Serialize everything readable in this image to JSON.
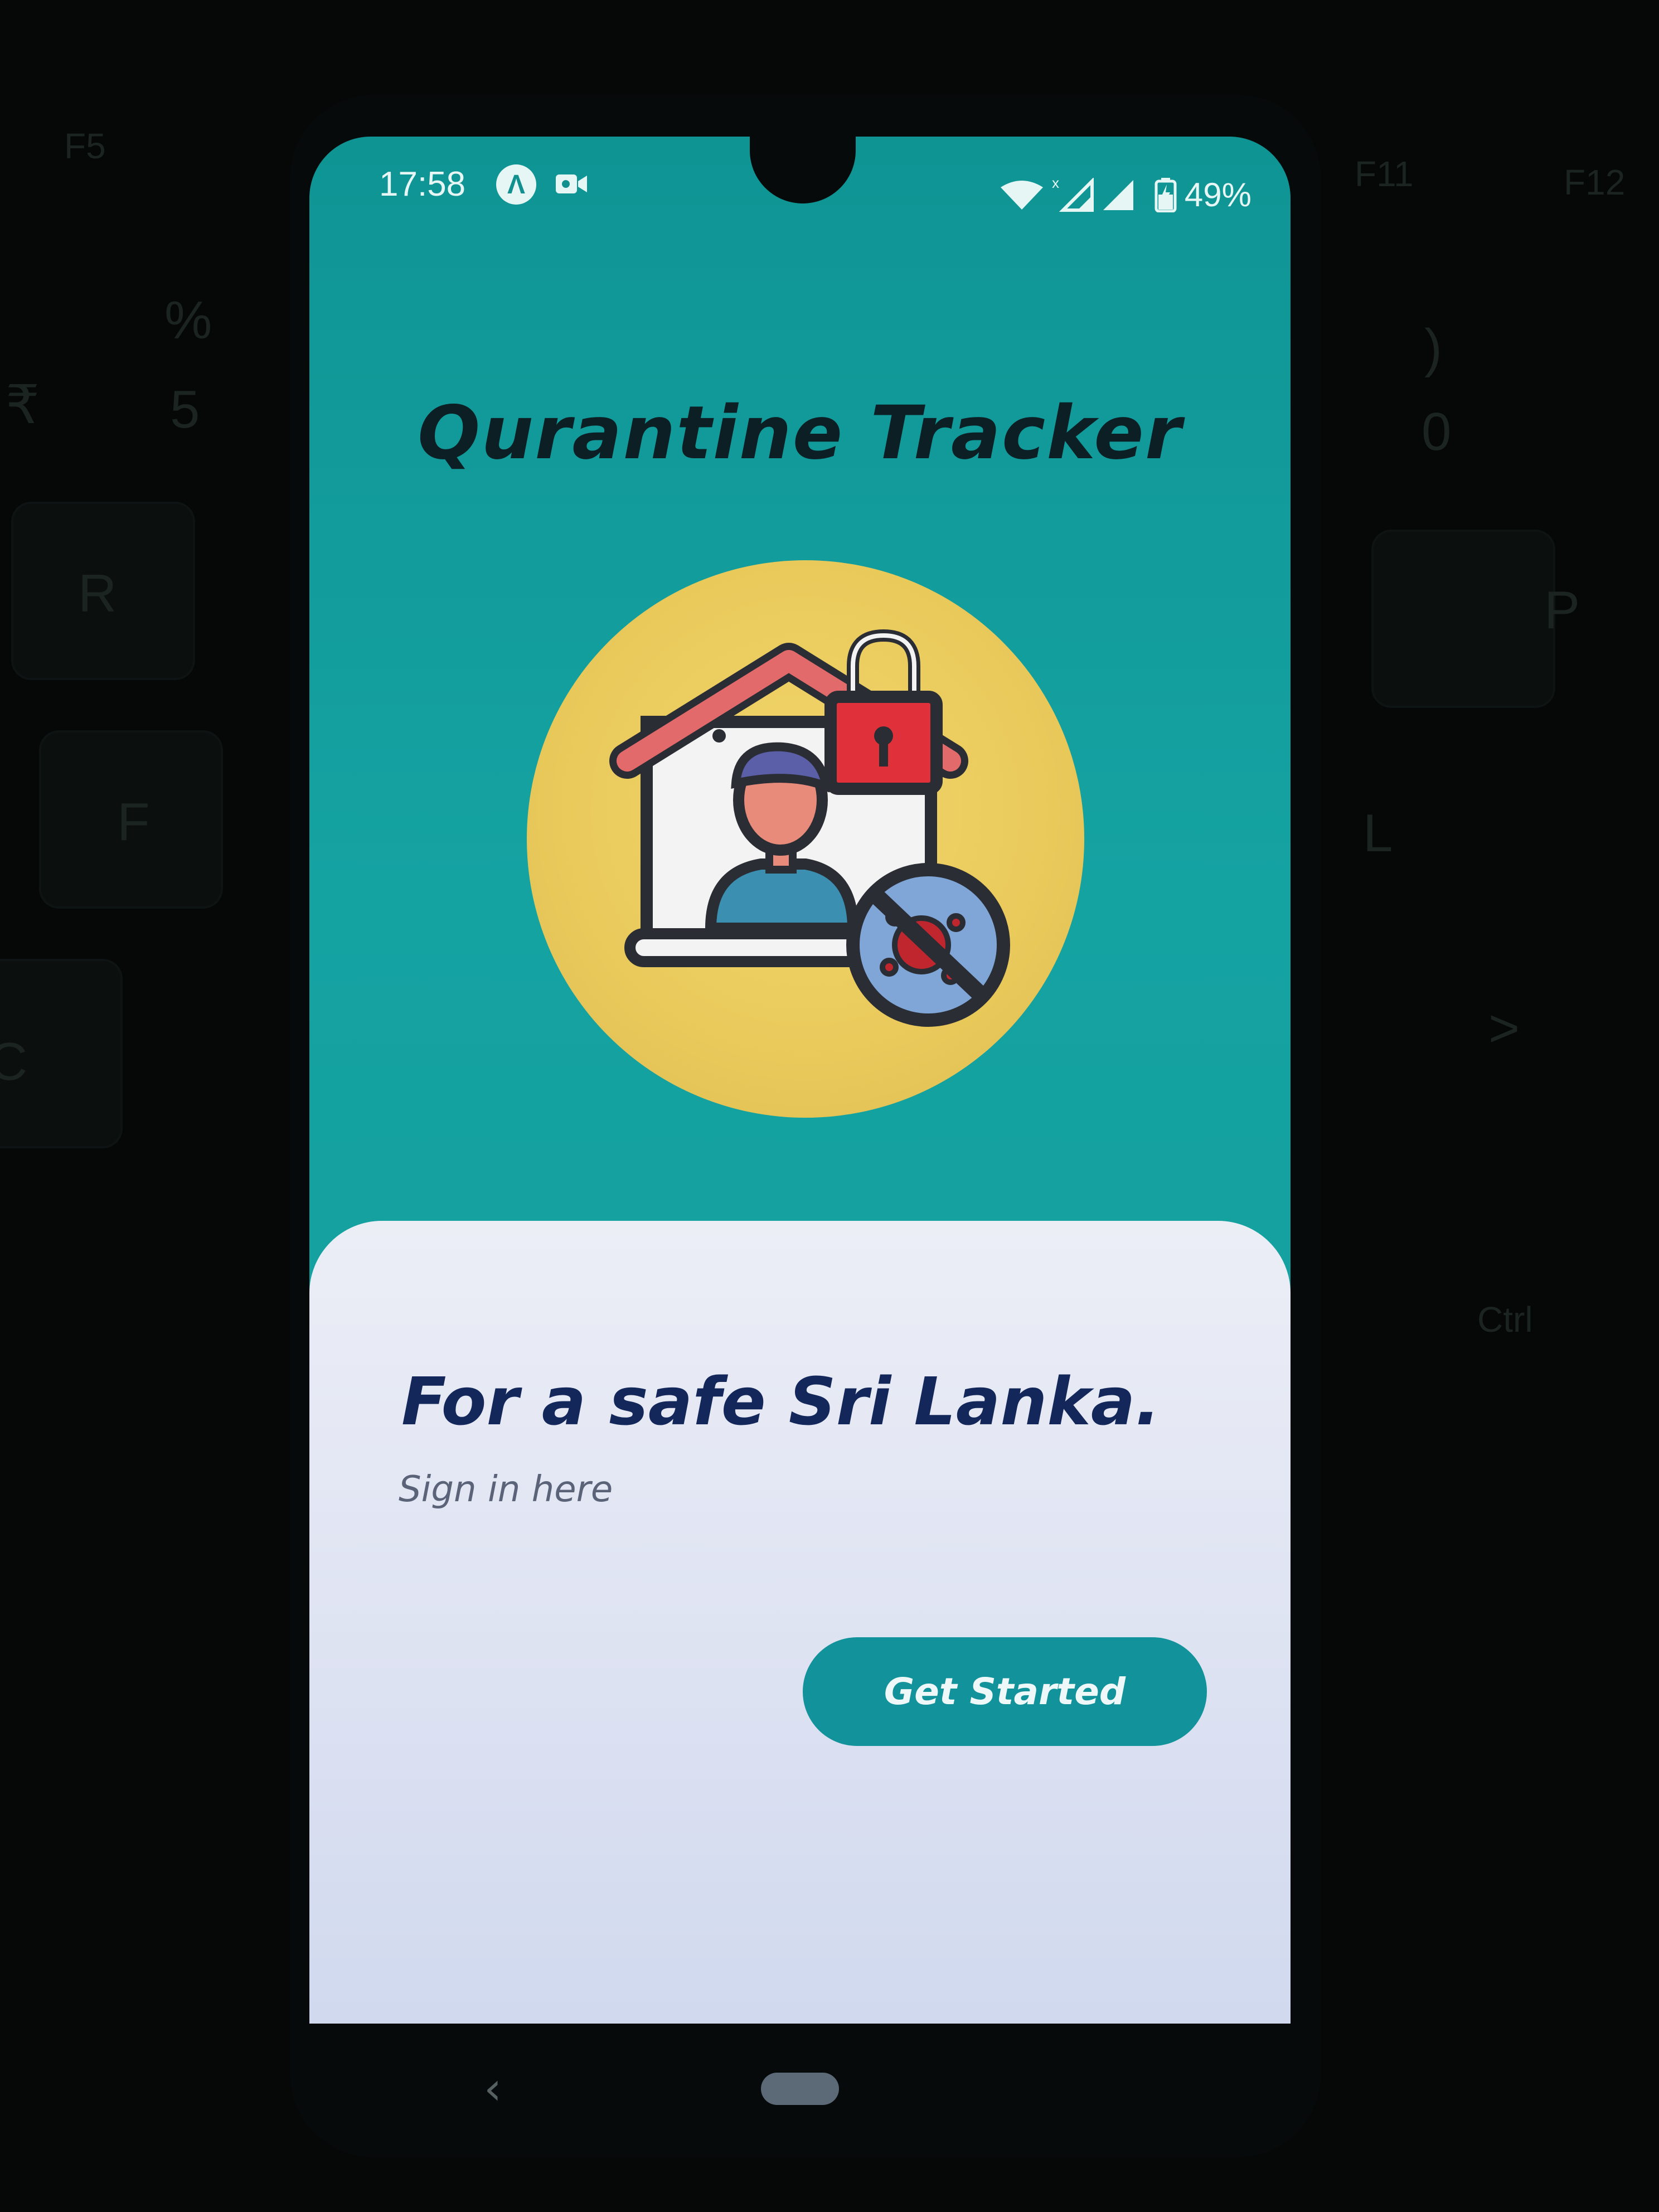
{
  "status_bar": {
    "time": "17:58",
    "app_icon_glyph": "Λ",
    "battery": "49%",
    "icons": [
      "app-notification-icon",
      "video-camera-icon",
      "wifi-icon",
      "signal-icon",
      "battery-icon"
    ]
  },
  "app": {
    "title": "Qurantine Tracker"
  },
  "card": {
    "heading": "For a safe Sri Lanka.",
    "subtitle": "Sign in here",
    "button_label": "Get Started"
  },
  "nav": {
    "back_glyph": "‹"
  },
  "background_keys": [
    "F5",
    "%",
    "₹",
    "5",
    "R",
    "F",
    "C",
    "F11",
    "F12",
    ")",
    "0",
    "P",
    "L",
    ">",
    "Ctrl"
  ],
  "colors": {
    "screen_bg": "#15a3a2",
    "hero_circle": "#e9c95a",
    "card_bg": "#dde2f2",
    "button_bg": "#12929a",
    "title_text": "#0b1f24",
    "heading_text": "#14275a"
  }
}
